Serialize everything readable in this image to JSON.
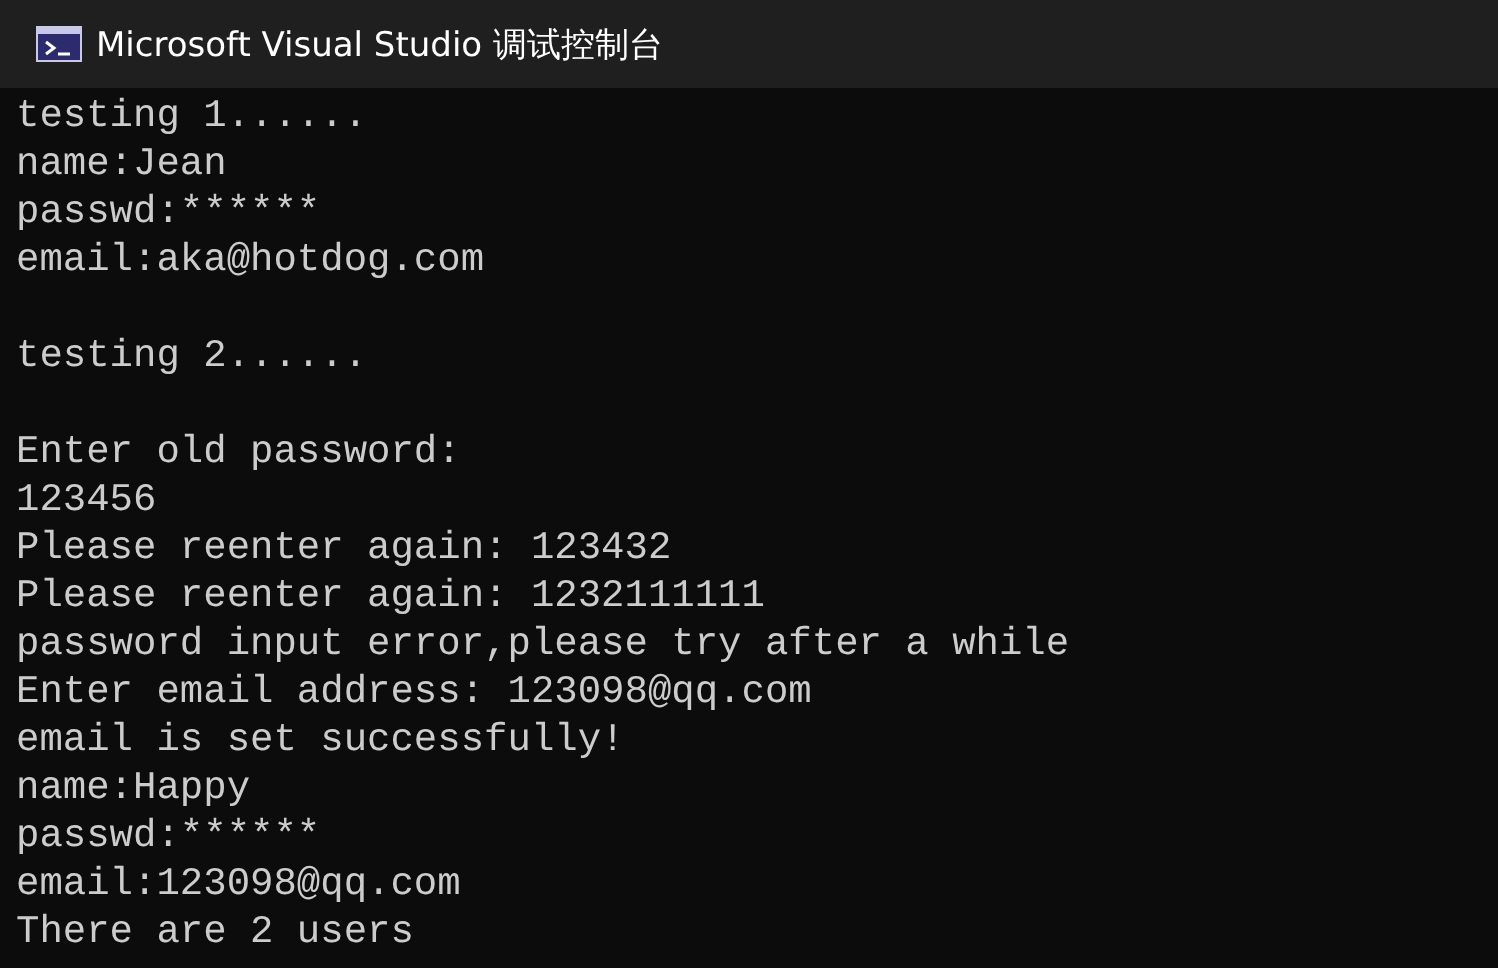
{
  "window": {
    "title": "Microsoft Visual Studio 调试控制台"
  },
  "console": {
    "blocks": [
      [
        "testing 1......",
        "name:Jean",
        "passwd:******",
        "email:aka@hotdog.com"
      ],
      [
        "testing 2......"
      ],
      [
        "Enter old password:",
        "123456",
        "Please reenter again: 123432",
        "Please reenter again: 1232111111",
        "password input error,please try after a while",
        "Enter email address: 123098@qq.com",
        "email is set successfully!",
        "name:Happy",
        "passwd:******",
        "email:123098@qq.com",
        "There are 2 users"
      ]
    ]
  }
}
